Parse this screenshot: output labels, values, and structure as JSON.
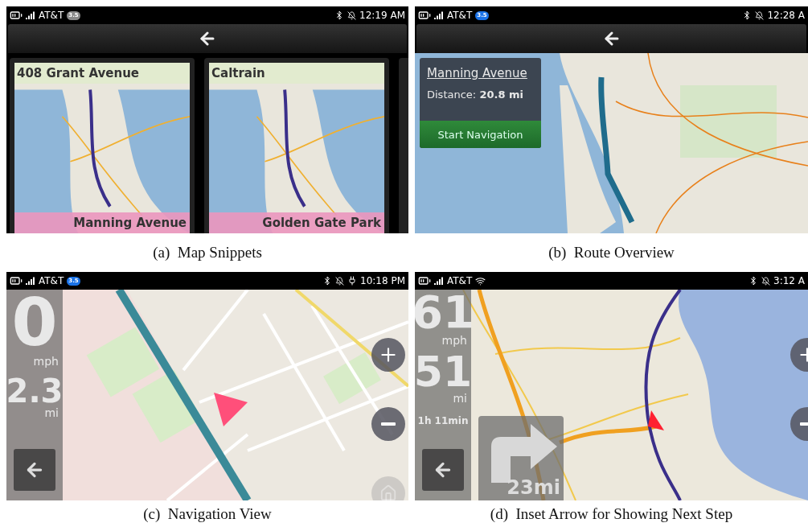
{
  "panels": [
    {
      "kind": "snippets",
      "status_bar": {
        "carrier": "AT&T",
        "network": {
          "kind": "badge",
          "text": "3.5",
          "active": false
        },
        "right_icons": [
          {
            "kind": "bluetooth"
          },
          {
            "kind": "silent"
          }
        ],
        "time": "12:19 AM"
      },
      "cards": [
        {
          "title": "408 Grant Avenue",
          "destination": "Manning Avenue"
        },
        {
          "title": "Caltrain",
          "destination": "Golden Gate Park"
        }
      ],
      "caption": "(a)  Map Snippets"
    },
    {
      "kind": "overview",
      "status_bar": {
        "carrier": "AT&T",
        "network": {
          "kind": "badge",
          "text": "3.5",
          "active": true
        },
        "right_icons": [
          {
            "kind": "bluetooth"
          },
          {
            "kind": "silent"
          }
        ],
        "time": "12:28 A"
      },
      "destination": "Manning Avenue",
      "distance_label": "Distance:",
      "distance": "20.8 mi",
      "button": "Start Navigation",
      "caption": "(b)  Route Overview"
    },
    {
      "kind": "navigation",
      "status_bar": {
        "carrier": "AT&T",
        "network": {
          "kind": "badge",
          "text": "3.5",
          "active": true
        },
        "right_icons": [
          {
            "kind": "bluetooth"
          },
          {
            "kind": "silent"
          },
          {
            "kind": "charging"
          }
        ],
        "time": "10:18 PM"
      },
      "speed": "0",
      "speed_unit": "mph",
      "remaining": "2.3",
      "remaining_unit": "mi",
      "controls": [
        {
          "kind": "zoom_in",
          "disabled": false
        },
        {
          "kind": "zoom_out",
          "disabled": false
        },
        {
          "kind": "home",
          "disabled": true
        }
      ],
      "caption": "(c)  Navigation View"
    },
    {
      "kind": "inset",
      "status_bar": {
        "carrier": "AT&T",
        "network": {
          "kind": "wifi"
        },
        "right_icons": [
          {
            "kind": "bluetooth"
          },
          {
            "kind": "silent"
          }
        ],
        "time": "3:12 A"
      },
      "speed": "61",
      "speed_unit": "mph",
      "remaining": "51",
      "remaining_unit": "mi",
      "eta": "1h 11min",
      "next_turn": "23mi",
      "controls": [
        {
          "kind": "zoom_in",
          "disabled": false
        },
        {
          "kind": "zoom_out",
          "disabled": false
        }
      ],
      "caption": "(d)  Inset Arrow for Showing Next Step"
    }
  ]
}
